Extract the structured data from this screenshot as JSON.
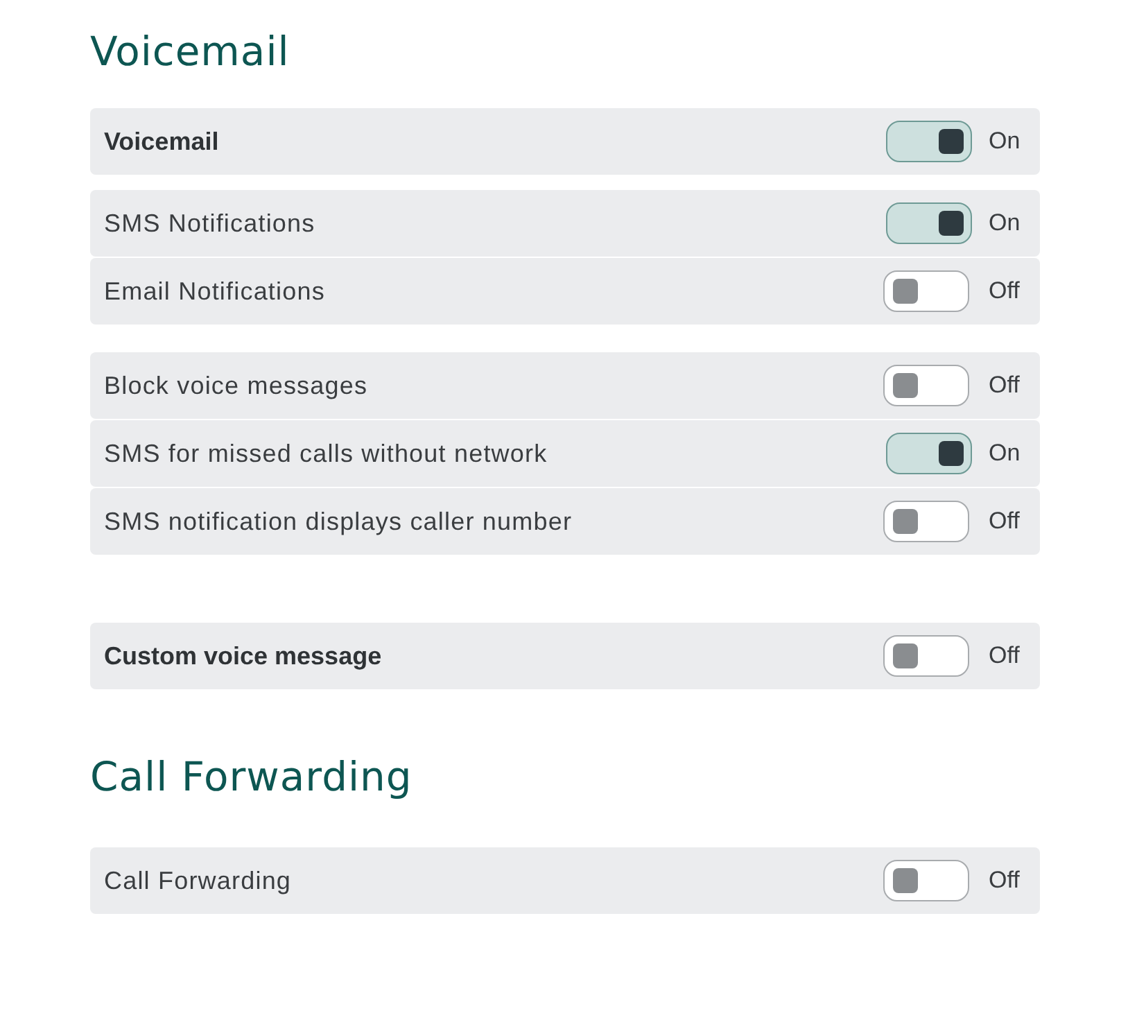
{
  "sections": [
    {
      "title": "Voicemail",
      "groups": [
        {
          "rows": [
            {
              "label": "Voicemail",
              "kind": "master",
              "on": true,
              "status": "On"
            }
          ]
        },
        {
          "rows": [
            {
              "label": "SMS Notifications",
              "kind": "option",
              "on": true,
              "status": "On"
            },
            {
              "label": "Email Notifications",
              "kind": "option",
              "on": false,
              "status": "Off"
            }
          ]
        },
        {
          "rows": [
            {
              "label": "Block voice messages",
              "kind": "option",
              "on": false,
              "status": "Off"
            },
            {
              "label": "SMS for missed calls without network",
              "kind": "option",
              "on": true,
              "status": "On"
            },
            {
              "label": "SMS notification displays caller number",
              "kind": "option",
              "on": false,
              "status": "Off"
            }
          ]
        },
        {
          "rows": [
            {
              "label": "Custom voice message",
              "kind": "master",
              "on": false,
              "status": "Off"
            }
          ]
        }
      ]
    },
    {
      "title": "Call Forwarding",
      "groups": [
        {
          "rows": [
            {
              "label": "Call Forwarding",
              "kind": "option",
              "on": false,
              "status": "Off"
            }
          ]
        }
      ]
    }
  ]
}
